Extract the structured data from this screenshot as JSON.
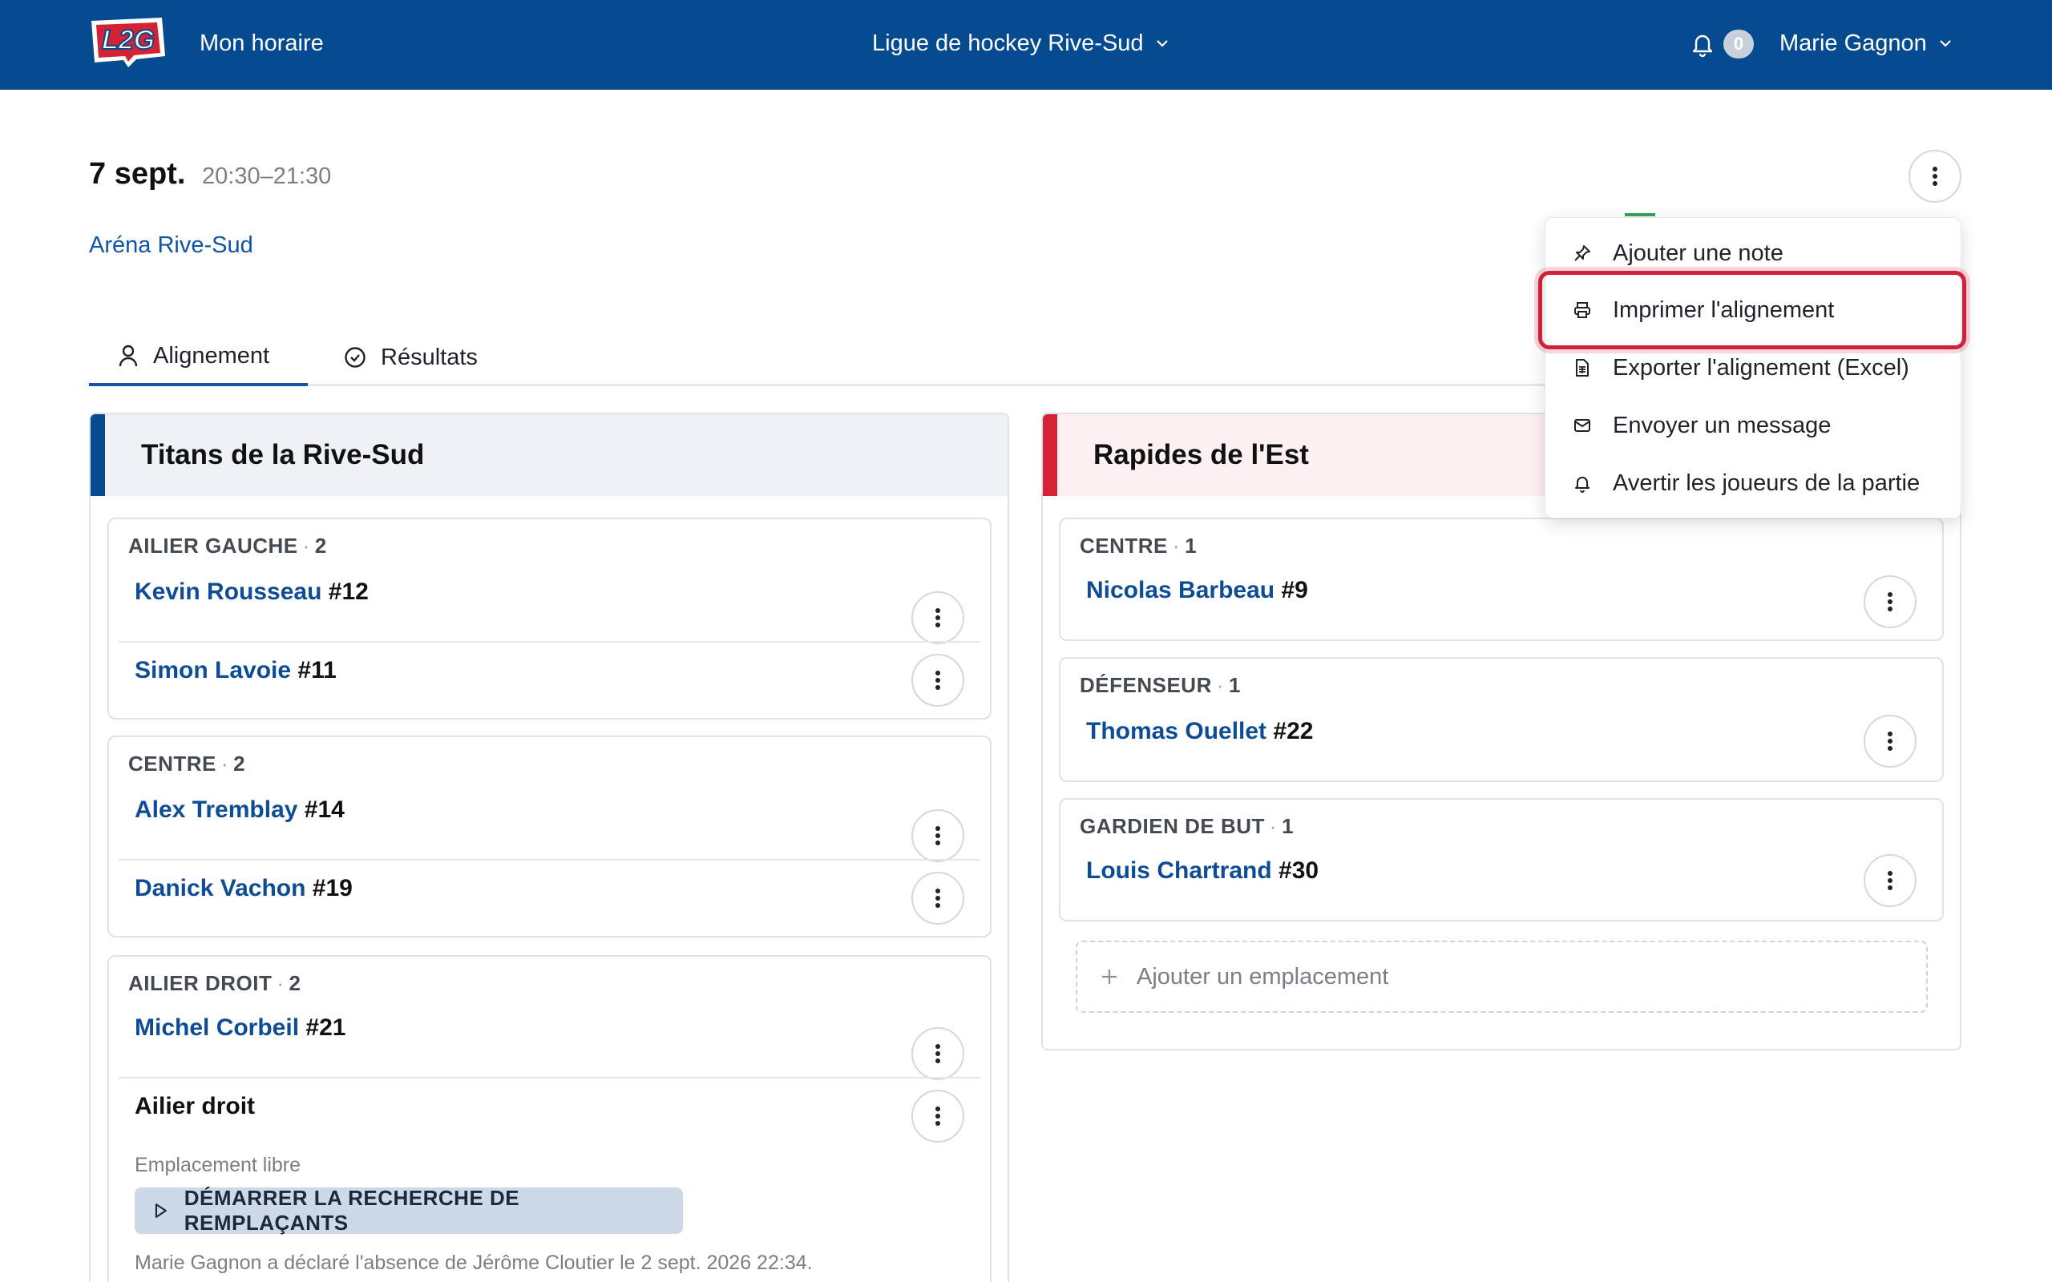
{
  "header": {
    "logo_text": "L2G",
    "app_title": "Mon horaire",
    "league_name": "Ligue de hockey Rive-Sud",
    "notification_count": "0",
    "user_name": "Marie Gagnon"
  },
  "event": {
    "date": "7 sept.",
    "time": "20:30–21:30",
    "venue": "Aréna Rive-Sud"
  },
  "tabs": [
    {
      "label": "Alignement",
      "icon": "person-icon",
      "active": true
    },
    {
      "label": "Résultats",
      "icon": "check-circle-icon",
      "active": false
    }
  ],
  "teams": [
    {
      "name": "Titans de la Rive-Sud",
      "accent": "#064a8f",
      "groups": [
        {
          "position": "AILIER GAUCHE",
          "count": "2",
          "players": [
            {
              "name": "Kevin Rousseau",
              "number": "#12"
            },
            {
              "name": "Simon Lavoie",
              "number": "#11"
            }
          ]
        },
        {
          "position": "CENTRE",
          "count": "2",
          "players": [
            {
              "name": "Alex Tremblay",
              "number": "#14"
            },
            {
              "name": "Danick Vachon",
              "number": "#19"
            }
          ]
        },
        {
          "position": "AILIER DROIT",
          "count": "2",
          "players": [
            {
              "name": "Michel Corbeil",
              "number": "#21"
            }
          ],
          "open_slot": {
            "title": "Ailier droit",
            "status": "Emplacement libre",
            "action": "DÉMARRER LA RECHERCHE DE REMPLAÇANTS",
            "note": "Marie Gagnon a déclaré l'absence de Jérôme Cloutier le 2 sept. 2026 22:34."
          }
        }
      ]
    },
    {
      "name": "Rapides de l'Est",
      "accent": "#d42235",
      "groups": [
        {
          "position": "CENTRE",
          "count": "1",
          "players": [
            {
              "name": "Nicolas Barbeau",
              "number": "#9"
            }
          ]
        },
        {
          "position": "DÉFENSEUR",
          "count": "1",
          "players": [
            {
              "name": "Thomas Ouellet",
              "number": "#22"
            }
          ]
        },
        {
          "position": "GARDIEN DE BUT",
          "count": "1",
          "players": [
            {
              "name": "Louis Chartrand",
              "number": "#30"
            }
          ]
        }
      ],
      "add_slot_label": "Ajouter un emplacement"
    }
  ],
  "menu": {
    "items": [
      {
        "label": "Ajouter une note",
        "icon": "pin-icon"
      },
      {
        "label": "Imprimer l'alignement",
        "icon": "printer-icon",
        "highlighted": true
      },
      {
        "label": "Exporter l'alignement (Excel)",
        "icon": "spreadsheet-icon"
      },
      {
        "label": "Envoyer un message",
        "icon": "envelope-icon"
      },
      {
        "label": "Avertir les joueurs de la partie",
        "icon": "bell-icon"
      }
    ],
    "highlight_color": "#d21f3c"
  }
}
